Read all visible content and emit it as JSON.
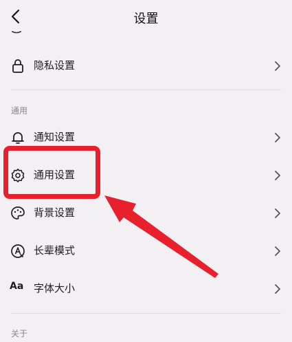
{
  "header": {
    "title": "设置"
  },
  "rows": {
    "privacy": {
      "label": "隐私设置"
    },
    "notify": {
      "label": "通知设置"
    },
    "general": {
      "label": "通用设置"
    },
    "background": {
      "label": "背景设置"
    },
    "elder": {
      "label": "长辈模式"
    },
    "font": {
      "label": "字体大小",
      "icon_text": "Aa"
    }
  },
  "sections": {
    "general": "通用",
    "about": "关于"
  },
  "colors": {
    "highlight": "#e8202e",
    "background": "#f3f0f3"
  },
  "icons": {
    "back": "chevron-left-icon",
    "privacy": "lock-icon",
    "notify": "bell-icon",
    "general": "gear-icon",
    "background": "palette-icon",
    "elder": "elder-mode-icon",
    "chevron": "chevron-right-icon"
  }
}
